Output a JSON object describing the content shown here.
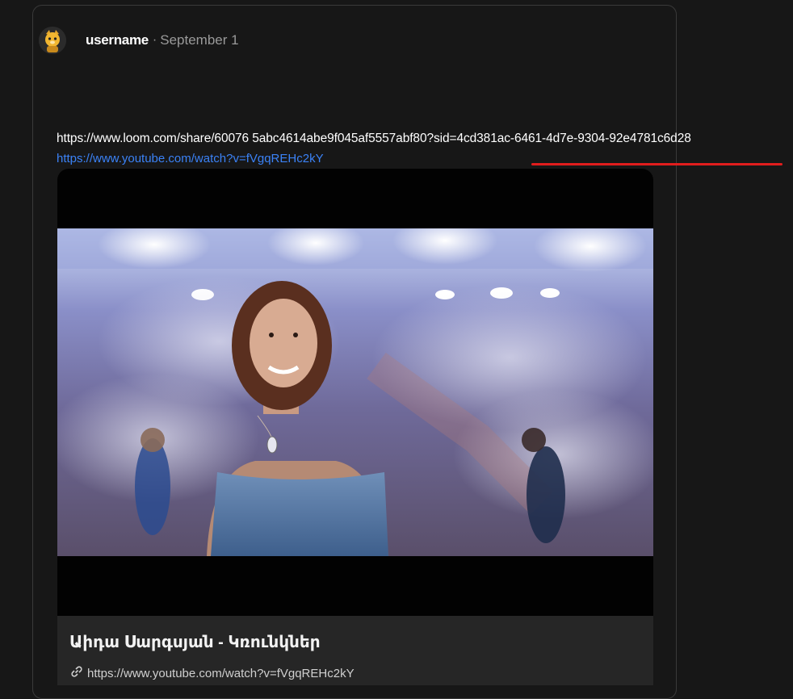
{
  "post": {
    "username": "username",
    "separator": "·",
    "date": "September 1",
    "loom_url": "https://www.loom.com/share/60076 5abc4614abe9f045af5557abf80?sid=4cd381ac-6461-4d7e-9304-92e4781c6d28",
    "youtube_url": "https://www.youtube.com/watch?v=fVgqREHc2kY"
  },
  "embed": {
    "title": "Աիդա Սարգսյան - Կռունկներ",
    "url": "https://www.youtube.com/watch?v=fVgqREHc2kY"
  },
  "colors": {
    "background": "#171717",
    "link": "#3b82f6",
    "annotation": "#e11d1d"
  }
}
